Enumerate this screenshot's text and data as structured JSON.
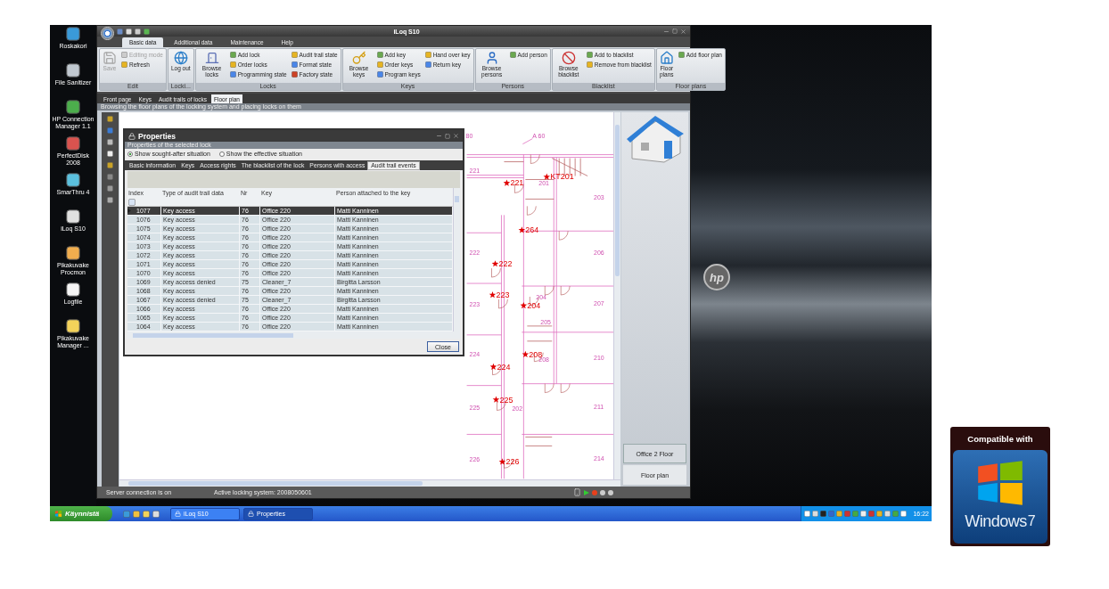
{
  "window": {
    "title": "iLoq S10"
  },
  "desktop_icons": [
    {
      "label": "Roskakori"
    },
    {
      "label": "File Sanitizer"
    },
    {
      "label": "HP Connection Manager 1.1"
    },
    {
      "label": "PerfectDisk 2008"
    },
    {
      "label": "SmarThru 4"
    },
    {
      "label": "iLoq S10"
    },
    {
      "label": "Pikakuvake Procmon"
    },
    {
      "label": "Logfile"
    },
    {
      "label": "Pikakuvake Manager ..."
    }
  ],
  "ribbon": {
    "tabs": [
      {
        "label": "Basic data",
        "selected": true
      },
      {
        "label": "Additional data",
        "selected": false
      },
      {
        "label": "Maintenance",
        "selected": false
      },
      {
        "label": "Help",
        "selected": false
      }
    ],
    "groups": [
      {
        "title": "Edit",
        "large": {
          "label": "Save",
          "disabled": true
        },
        "columns": [
          [
            {
              "label": "Editing mode",
              "disabled": true
            },
            {
              "label": "Refresh",
              "disabled": false
            }
          ]
        ]
      },
      {
        "title": "Locki...",
        "large": {
          "label": "Log out",
          "disabled": false
        }
      },
      {
        "title": "Locks",
        "large": {
          "label": "Browse locks",
          "disabled": false
        },
        "columns": [
          [
            {
              "label": "Add lock",
              "disabled": false
            },
            {
              "label": "Order locks",
              "disabled": false
            },
            {
              "label": "Programming state",
              "disabled": false
            }
          ],
          [
            {
              "label": "Audit trail state",
              "disabled": false
            },
            {
              "label": "Format state",
              "disabled": false
            },
            {
              "label": "Factory state",
              "disabled": false
            }
          ]
        ]
      },
      {
        "title": "Keys",
        "large": {
          "label": "Browse keys",
          "disabled": false
        },
        "columns": [
          [
            {
              "label": "Add key",
              "disabled": false
            },
            {
              "label": "Order keys",
              "disabled": false
            },
            {
              "label": "Program keys",
              "disabled": false
            }
          ],
          [
            {
              "label": "Hand over key",
              "disabled": false
            },
            {
              "label": "Return key",
              "disabled": false
            }
          ]
        ]
      },
      {
        "title": "Persons",
        "large": {
          "label": "Browse persons",
          "disabled": false
        },
        "columns": [
          [
            {
              "label": "Add person",
              "disabled": false
            }
          ]
        ]
      },
      {
        "title": "Blacklist",
        "large": {
          "label": "Browse blacklist",
          "disabled": false
        },
        "columns": [
          [
            {
              "label": "Add to blacklist",
              "disabled": false
            },
            {
              "label": "Remove from blacklist",
              "disabled": false
            }
          ]
        ]
      },
      {
        "title": "Floor plans",
        "large": {
          "label": "Floor plans",
          "disabled": false
        },
        "columns": [
          [
            {
              "label": "Add floor plan",
              "disabled": false
            }
          ]
        ]
      }
    ]
  },
  "document_tabs": [
    {
      "label": "Front page",
      "selected": false
    },
    {
      "label": "Keys",
      "selected": false
    },
    {
      "label": "Audit trails of locks",
      "selected": false
    },
    {
      "label": "Floor plan",
      "selected": true
    }
  ],
  "description": "Browsing the floor plans of the locking system and placing locks on them",
  "floor_plan": {
    "top_labels": [
      "80",
      "A 60"
    ],
    "room_labels": [
      "221",
      "201",
      "203",
      "206",
      "222",
      "207",
      "204",
      "223",
      "205",
      "224",
      "208",
      "210",
      "225",
      "202",
      "211",
      "226",
      "214"
    ],
    "locks": [
      {
        "label": "221"
      },
      {
        "label": "KT201"
      },
      {
        "label": "264"
      },
      {
        "label": "222"
      },
      {
        "label": "223"
      },
      {
        "label": "204"
      },
      {
        "label": "208"
      },
      {
        "label": "224"
      },
      {
        "label": "225"
      },
      {
        "label": "226"
      }
    ],
    "plans": [
      {
        "label": "Office 2 Floor",
        "selected": true
      },
      {
        "label": "Floor plan",
        "selected": false
      }
    ]
  },
  "status_bar": {
    "connection": "Server connection is on",
    "system": "Active locking system: 2008050601"
  },
  "dialog": {
    "title": "Properties",
    "subtitle": "Properties of the selected lock",
    "radios": [
      {
        "label": "Show sought-after situation",
        "selected": true
      },
      {
        "label": "Show the effective situation",
        "selected": false
      }
    ],
    "tabs": [
      {
        "label": "Basic information",
        "selected": false
      },
      {
        "label": "Keys",
        "selected": false
      },
      {
        "label": "Access rights",
        "selected": false
      },
      {
        "label": "The blacklist of the lock",
        "selected": false
      },
      {
        "label": "Persons with access",
        "selected": false
      },
      {
        "label": "Audit trail events",
        "selected": true
      }
    ],
    "columns": [
      "Index",
      "Type of audit trail data",
      "Nr",
      "Key",
      "Person attached to the key"
    ],
    "rows": [
      {
        "cells": [
          "1077",
          "Key access",
          "76",
          "Office 220",
          "Matti Kanninen"
        ],
        "selected": true
      },
      {
        "cells": [
          "1076",
          "Key access",
          "76",
          "Office 220",
          "Matti Kanninen"
        ],
        "selected": false
      },
      {
        "cells": [
          "1075",
          "Key access",
          "76",
          "Office 220",
          "Matti Kanninen"
        ],
        "selected": false
      },
      {
        "cells": [
          "1074",
          "Key access",
          "76",
          "Office 220",
          "Matti Kanninen"
        ],
        "selected": false
      },
      {
        "cells": [
          "1073",
          "Key access",
          "76",
          "Office 220",
          "Matti Kanninen"
        ],
        "selected": false
      },
      {
        "cells": [
          "1072",
          "Key access",
          "76",
          "Office 220",
          "Matti Kanninen"
        ],
        "selected": false
      },
      {
        "cells": [
          "1071",
          "Key access",
          "76",
          "Office 220",
          "Matti Kanninen"
        ],
        "selected": false
      },
      {
        "cells": [
          "1070",
          "Key access",
          "76",
          "Office 220",
          "Matti Kanninen"
        ],
        "selected": false
      },
      {
        "cells": [
          "1069",
          "Key access denied",
          "75",
          "Cleaner_7",
          "Birgitta Larsson"
        ],
        "selected": false
      },
      {
        "cells": [
          "1068",
          "Key access",
          "76",
          "Office 220",
          "Matti Kanninen"
        ],
        "selected": false
      },
      {
        "cells": [
          "1067",
          "Key access denied",
          "75",
          "Cleaner_7",
          "Birgitta Larsson"
        ],
        "selected": false
      },
      {
        "cells": [
          "1066",
          "Key access",
          "76",
          "Office 220",
          "Matti Kanninen"
        ],
        "selected": false
      },
      {
        "cells": [
          "1065",
          "Key access",
          "76",
          "Office 220",
          "Matti Kanninen"
        ],
        "selected": false
      },
      {
        "cells": [
          "1064",
          "Key access",
          "76",
          "Office 220",
          "Matti Kanninen"
        ],
        "selected": false
      }
    ],
    "close": "Close"
  },
  "taskbar": {
    "start": "Käynnistä",
    "tasks": [
      {
        "label": "iLoq S10",
        "selected": false
      },
      {
        "label": "Properties",
        "selected": true
      }
    ],
    "clock": "16:22"
  },
  "desktop_logo": "hp",
  "badge": {
    "heading": "Compatible with",
    "product": "Windows",
    "version": "7"
  }
}
